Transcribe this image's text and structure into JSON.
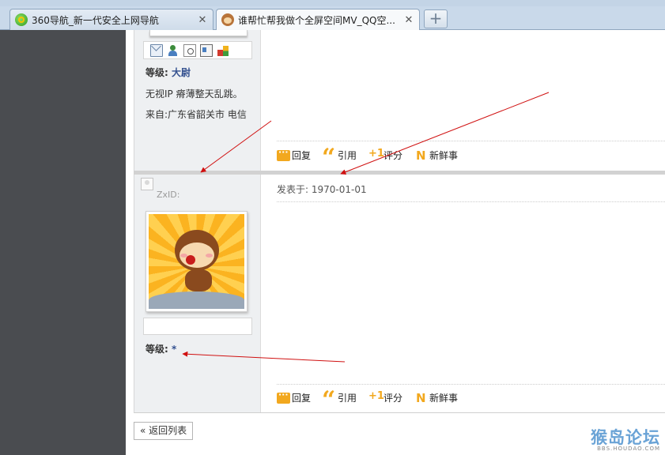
{
  "tabs": [
    {
      "title": "360导航_新一代安全上网导航",
      "close": "✕"
    },
    {
      "title": "谁帮忙帮我做个全屏空间MV_QQ空...",
      "close": "✕"
    }
  ],
  "new_tab": "+",
  "post1": {
    "rank_label": "等级:",
    "rank_value": "大尉",
    "line1": "无视IP 瘠薄整天乱跳。",
    "line2": "来自:广东省韶关市 电信"
  },
  "post2": {
    "username": "ZxID:",
    "posted": "发表于: 1970-01-01",
    "rank_label": "等级:",
    "rank_value": "*"
  },
  "actions": {
    "reply": "回复",
    "quote": "引用",
    "rate": "评分",
    "news": "新鲜事"
  },
  "back_button": "« 返回列表",
  "watermark": {
    "main": "猴岛论坛",
    "sub": "BBS.HOUDAO.COM"
  },
  "colors": {
    "arrow": "#d01010",
    "rank_link": "#33508f",
    "icon_accent": "#f2a81e"
  }
}
